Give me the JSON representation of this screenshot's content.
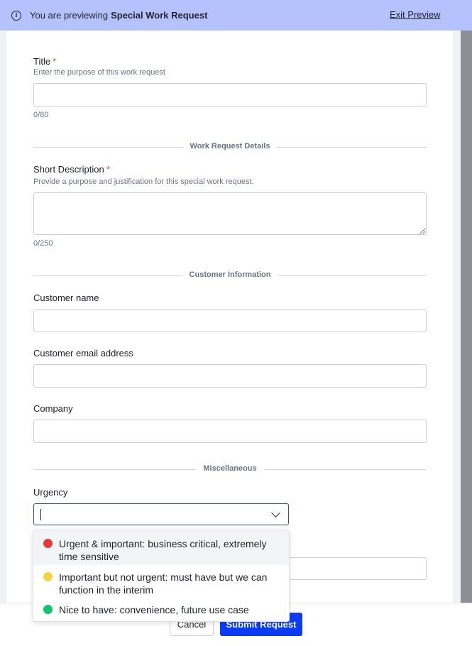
{
  "banner": {
    "prefix": "You are previewing",
    "form_name": "Special Work Request",
    "exit_label": "Exit Preview"
  },
  "form": {
    "title": {
      "label": "Title",
      "required_mark": "*",
      "hint": "Enter the purpose of this work request",
      "counter": "0/80",
      "value": ""
    },
    "section_details": "Work Request Details",
    "short_description": {
      "label": "Short Description",
      "required_mark": "*",
      "hint": "Provide a purpose and justification for this special work request.",
      "counter": "0/250",
      "value": ""
    },
    "section_customer": "Customer Information",
    "customer_name": {
      "label": "Customer name",
      "value": ""
    },
    "customer_email": {
      "label": "Customer email address",
      "value": ""
    },
    "company": {
      "label": "Company",
      "value": ""
    },
    "section_misc": "Miscellaneous",
    "urgency": {
      "label": "Urgency",
      "value": "",
      "options": [
        {
          "label": "Urgent & important: business critical, extremely time sensitive",
          "color": "#e83a35"
        },
        {
          "label": "Important but not urgent: must have but we can function in the interim",
          "color": "#f5d240"
        },
        {
          "label": "Nice to have: convenience, future use case",
          "color": "#10c56a"
        }
      ]
    }
  },
  "footer": {
    "cancel_label": "Cancel",
    "submit_label": "Submit Request"
  },
  "colors": {
    "banner_bg": "#b6c2fb",
    "primary": "#0a3cf5",
    "required": "#e5484d"
  }
}
